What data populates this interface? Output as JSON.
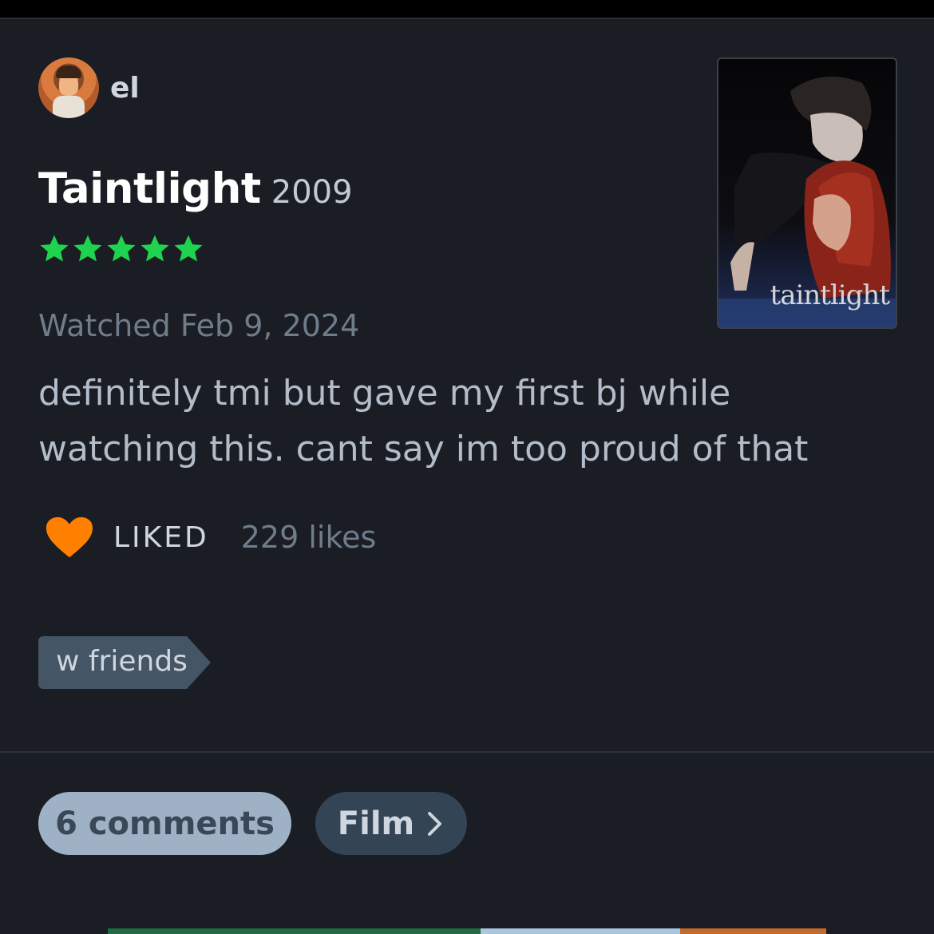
{
  "review": {
    "username": "el",
    "film_title": "Taintlight",
    "film_year": "2009",
    "rating_stars": 5,
    "watched_text": "Watched Feb 9, 2024",
    "body": "definitely tmi but gave my first bj while watching this. cant say im too proud of that",
    "poster_title": "taintlight",
    "liked_label": "LIKED",
    "likes_count": "229 likes",
    "tag": "w friends"
  },
  "actions": {
    "comments_label": "6 comments",
    "film_label": "Film"
  },
  "colors": {
    "background": "#1a1d23",
    "star": "#1fd34e",
    "heart": "#ff8000",
    "tag_bg": "#445566",
    "comments_bg": "#9fb1c4",
    "film_bg": "#334455"
  },
  "icons": {
    "star": "star-icon",
    "heart": "heart-icon",
    "chevron": "chevron-right-icon"
  }
}
